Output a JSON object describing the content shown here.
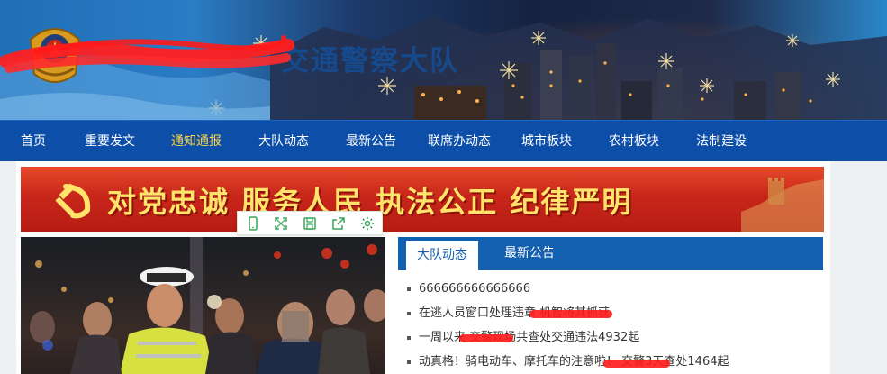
{
  "header": {
    "title": "交通警察大队",
    "colors": {
      "nav": "#0d4fa8",
      "active_nav": "#ffd54a",
      "tab_bar": "#1460b0",
      "banner_red": "#c8261a",
      "banner_text": "#ffe36b"
    }
  },
  "nav": {
    "items": [
      {
        "label": "首页"
      },
      {
        "label": "重要发文"
      },
      {
        "label": "通知通报",
        "active": true
      },
      {
        "label": "大队动态"
      },
      {
        "label": "最新公告"
      },
      {
        "label": "联席办动态"
      },
      {
        "label": "城市板块"
      },
      {
        "label": "农村板块"
      },
      {
        "label": "法制建设"
      }
    ]
  },
  "banner": {
    "slogan": "对党忠诚 服务人民 执法公正 纪律严明"
  },
  "toolbar": {
    "icons": [
      "mobile-icon",
      "expand-icon",
      "save-icon",
      "share-icon",
      "settings-icon"
    ]
  },
  "tabs": {
    "items": [
      {
        "label": "大队动态",
        "active": true
      },
      {
        "label": "最新公告",
        "active": false
      }
    ]
  },
  "news": {
    "items": [
      {
        "title": "666666666666666"
      },
      {
        "title": "在逃人员窗口处理违章        机智将其抓获"
      },
      {
        "title": "一周以来       交警现场共查处交通违法4932起"
      },
      {
        "title": "动真格！骑电动车、摩托车的注意啦！        交警3天查处1464起"
      }
    ]
  }
}
